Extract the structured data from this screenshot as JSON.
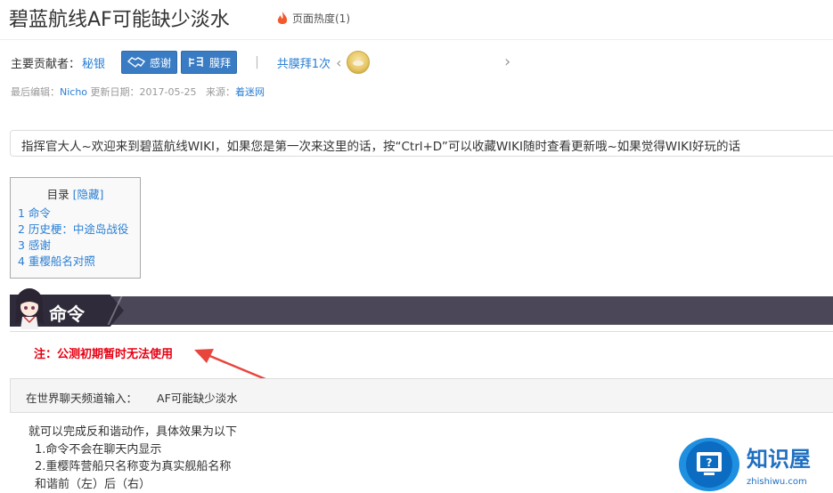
{
  "page": {
    "title": "碧蓝航线AF可能缺少淡水",
    "heat_label": "页面热度(1)"
  },
  "contributors": {
    "label": "主要贡献者：",
    "name": "秘银",
    "thanks_button": "感谢",
    "worship_button": "膜拜",
    "worship_count": "共膜拜1次"
  },
  "meta": {
    "last_editor_label": "最后编辑：",
    "last_editor": "Nicho",
    "update_label": "更新日期：",
    "update_date": "2017-05-25",
    "source_label": "来源：",
    "source": "着迷网"
  },
  "notice": "指挥官大人~欢迎来到碧蓝航线WIKI，如果您是第一次来这里的话，按“Ctrl+D”可以收藏WIKI随时查看更新哦~如果觉得WIKI好玩的话",
  "toc": {
    "title": "目录",
    "hide_label": "[隐藏]",
    "items": [
      "1  命令",
      "2  历史梗：中途岛战役",
      "3  感谢",
      "4  重樱船名对照"
    ]
  },
  "section": {
    "title": "命令",
    "note": "注：公测初期暂时无法使用",
    "command_label": "在世界聊天频道输入：",
    "command_value": "AF可能缺少淡水",
    "lines": [
      "就可以完成反和谐动作，具体效果为以下",
      "1.命令不会在聊天内显示",
      "2.重樱阵营船只名称变为真实舰船名称",
      "和谐前（左）后（右）"
    ]
  },
  "watermark": {
    "name": "知识屋",
    "domain": "zhishiwu.com"
  },
  "colors": {
    "link": "#2a7fd4",
    "button": "#3a7cc4",
    "note": "#e60012",
    "section_band": "#4b4759",
    "arrow": "#e8453c"
  }
}
